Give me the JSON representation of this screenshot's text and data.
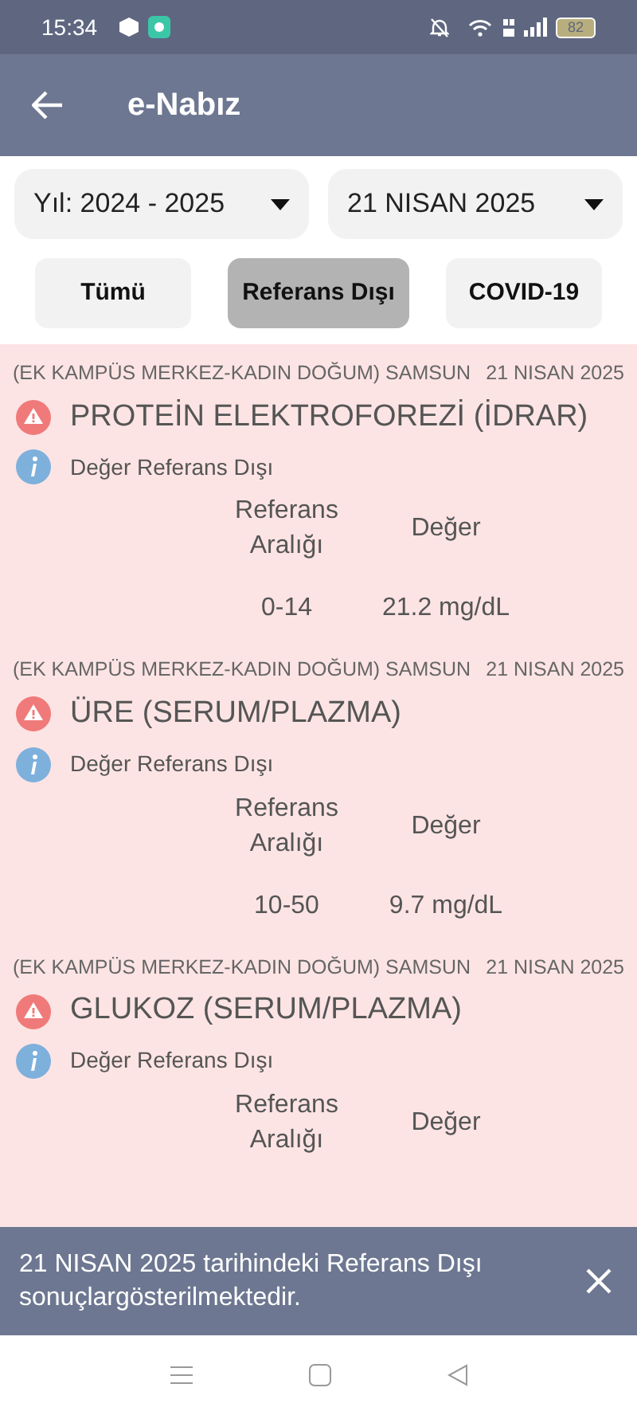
{
  "status_bar": {
    "time": "15:34",
    "battery": "82"
  },
  "app_bar": {
    "title": "e-Nabız"
  },
  "filters": [
    {
      "value": "Yıl: 2024 - 2025"
    },
    {
      "value": "21 NISAN 2025"
    }
  ],
  "tabs": [
    {
      "label": "Tümü",
      "selected": false
    },
    {
      "label": "Referans Dışı",
      "selected": true
    },
    {
      "label": "COVID-19",
      "selected": false
    }
  ],
  "results": [
    {
      "hospital": "(EK KAMPÜS MERKEZ-KADIN DOĞUM) SAMSUN",
      "date": "21 NISAN 2025",
      "test": "PROTEİN ELEKTROFOREZİ (İDRAR)",
      "note": "Değer Referans Dışı",
      "range_header": "Referans Aralığı",
      "value_header": "Değer",
      "range": "0-14",
      "value": "21.2 mg/dL"
    },
    {
      "hospital": "(EK KAMPÜS MERKEZ-KADIN DOĞUM) SAMSUN",
      "date": "21 NISAN 2025",
      "test": "ÜRE (SERUM/PLAZMA)",
      "note": "Değer Referans Dışı",
      "range_header": "Referans Aralığı",
      "value_header": "Değer",
      "range": "10-50",
      "value": "9.7 mg/dL"
    },
    {
      "hospital": "(EK KAMPÜS MERKEZ-KADIN DOĞUM) SAMSUN",
      "date": "21 NISAN 2025",
      "test": "GLUKOZ (SERUM/PLAZMA)",
      "note": "Değer Referans Dışı",
      "range_header": "Referans Aralığı",
      "value_header": "Değer"
    }
  ],
  "snackbar": {
    "message": "21 NISAN 2025 tarihindeki Referans Dışı sonuçlargösterilmektedir."
  }
}
